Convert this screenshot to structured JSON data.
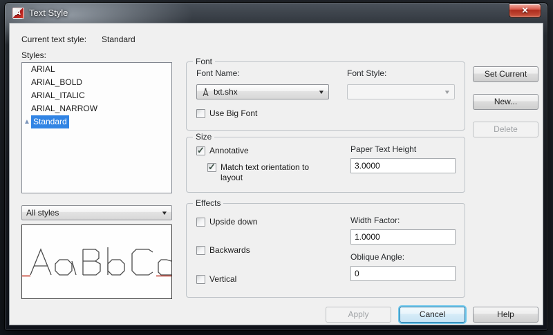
{
  "icons": {
    "app_letter": "A",
    "close": "✕",
    "dropdown_arrow": "▼",
    "check": "✓",
    "annotative_triangle": "▲"
  },
  "window": {
    "title": "Text Style"
  },
  "header": {
    "current_label": "Current text style:",
    "current_value": "Standard"
  },
  "styles_panel": {
    "label": "Styles:",
    "items": [
      {
        "name": "ARIAL"
      },
      {
        "name": "ARIAL_BOLD"
      },
      {
        "name": "ARIAL_ITALIC"
      },
      {
        "name": "ARIAL_NARROW"
      },
      {
        "name": "Standard"
      }
    ],
    "selected": "Standard",
    "filter_value": "All styles"
  },
  "font_group": {
    "title": "Font",
    "font_name_label": "Font Name:",
    "font_name_value": "txt.shx",
    "font_style_label": "Font Style:",
    "font_style_value": "",
    "use_big_font_label": "Use Big Font"
  },
  "size_group": {
    "title": "Size",
    "annotative_label": "Annotative",
    "match_orientation_label": "Match text orientation to layout",
    "paper_height_label": "Paper Text Height",
    "paper_height_value": "3.0000"
  },
  "effects_group": {
    "title": "Effects",
    "upside_down_label": "Upside down",
    "backwards_label": "Backwards",
    "vertical_label": "Vertical",
    "width_factor_label": "Width Factor:",
    "width_factor_value": "1.0000",
    "oblique_label": "Oblique Angle:",
    "oblique_value": "0"
  },
  "side_buttons": {
    "set_current": "Set Current",
    "new": "New...",
    "delete": "Delete"
  },
  "bottom_buttons": {
    "apply": "Apply",
    "cancel": "Cancel",
    "help": "Help"
  },
  "colors": {
    "selection_blue": "#3184e4",
    "close_red": "#c14a36",
    "preview_mark_red": "#c0392b",
    "dialog_bg": "#f0f0f0"
  }
}
